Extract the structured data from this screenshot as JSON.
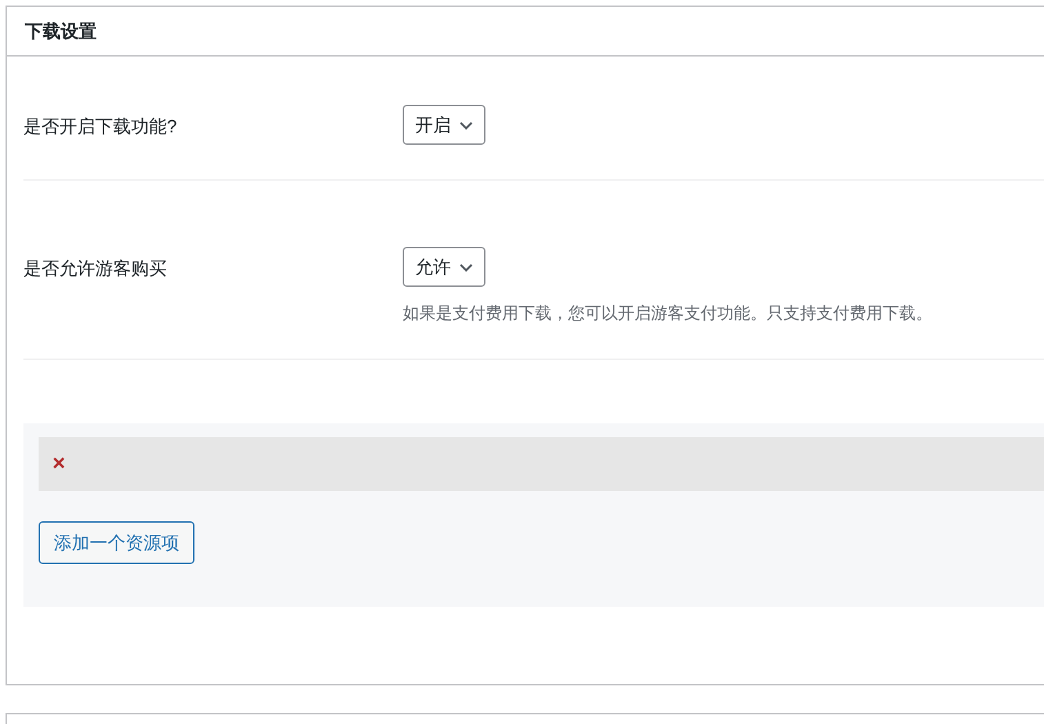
{
  "panel": {
    "title": "下载设置"
  },
  "settings": [
    {
      "label": "是否开启下载功能?",
      "value": "开启"
    },
    {
      "label": "是否允许游客购买",
      "value": "允许",
      "hint": "如果是支付费用下载，您可以开启游客支付功能。只支持支付费用下载。"
    }
  ],
  "resources": {
    "items": [
      {
        "remove": "×"
      }
    ],
    "add_button": "添加一个资源项"
  }
}
